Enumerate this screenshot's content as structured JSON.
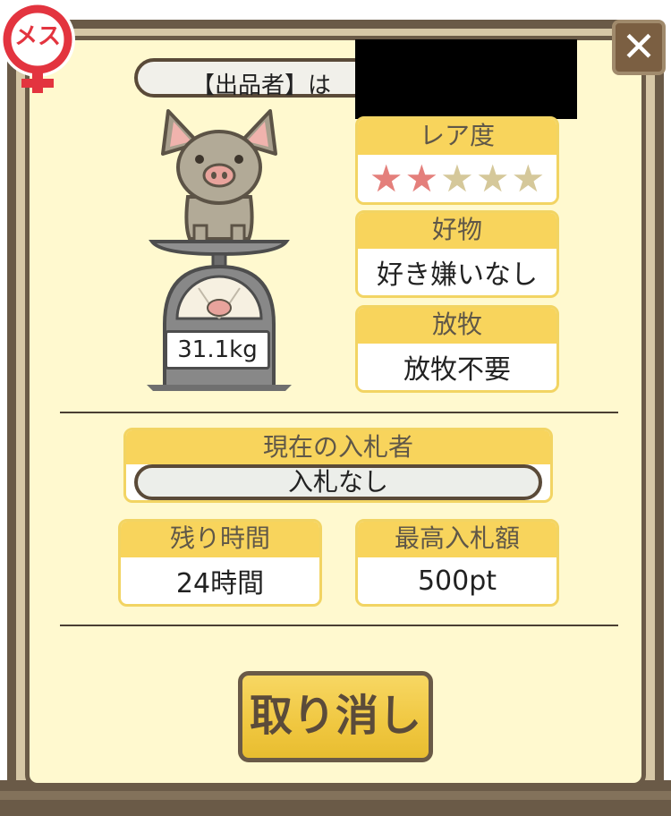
{
  "dialog": {
    "close_label": "✕",
    "gender_label": "メス",
    "seller_label": "【出品者】は",
    "weight": "31.1kg",
    "rarity": {
      "label": "レア度",
      "stars_filled": 2,
      "stars_total": 5
    },
    "favorite": {
      "label": "好物",
      "value": "好き嫌いなし"
    },
    "grazing": {
      "label": "放牧",
      "value": "放牧不要"
    },
    "current_bidder": {
      "label": "現在の入札者",
      "value": "入札なし"
    },
    "time_left": {
      "label": "残り時間",
      "value": "24時間"
    },
    "highest_bid": {
      "label": "最高入札額",
      "value": "500pt"
    },
    "cancel_button": "取り消し"
  },
  "colors": {
    "panel_bg": "#fff9cf",
    "frame": "#6a5a47",
    "header_yellow": "#f8d45c",
    "star_on": "#e47f7b",
    "star_off": "#d5c89a",
    "gender_pink": "#e3343f"
  }
}
